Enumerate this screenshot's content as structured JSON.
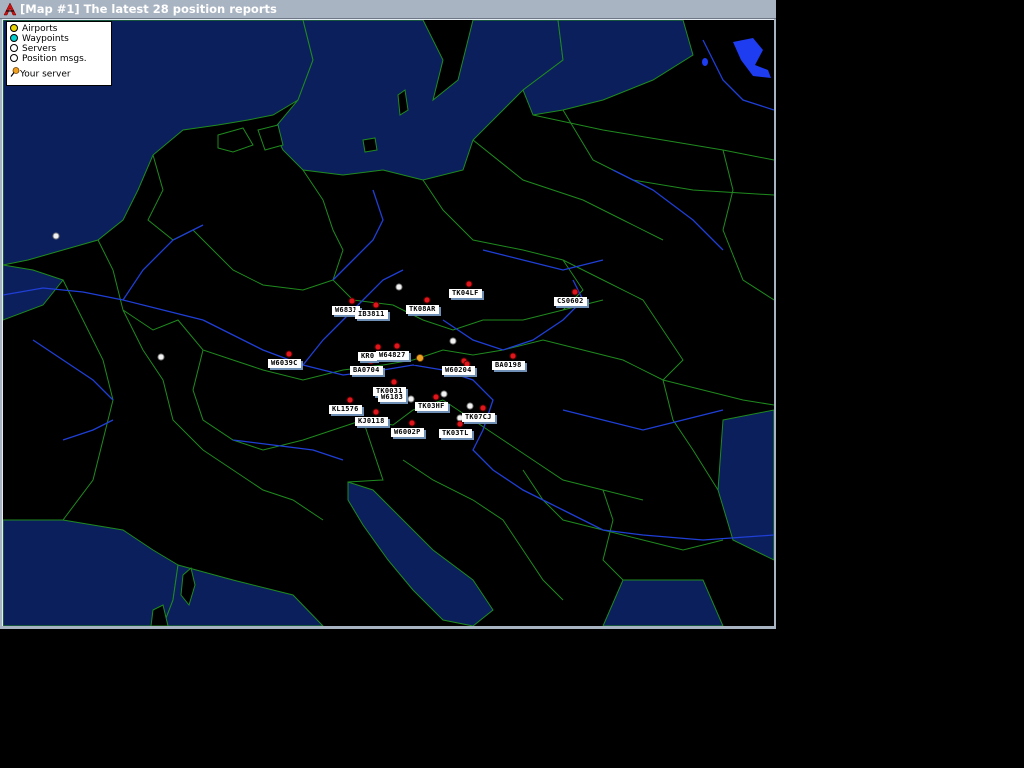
{
  "window": {
    "title": "[Map #1] The latest 28 position reports",
    "colors": {
      "titlebar": "#a9b4c2",
      "sea": "#0b1f5c",
      "land": "#000000",
      "borders": "#1f8a1f",
      "rivers": "#1f3fd6",
      "report_marker": "#e0161c"
    }
  },
  "legend": {
    "items": [
      {
        "label": "Airports",
        "icon": "yellow-dot",
        "color": "#e8d400"
      },
      {
        "label": "Waypoints",
        "icon": "cyan-dot",
        "color": "#00d0d0"
      },
      {
        "label": "Servers",
        "icon": "white-dot",
        "color": "#ffffff"
      },
      {
        "label": "Position msgs.",
        "icon": "white-dot",
        "color": "#ffffff"
      },
      {
        "label": "Your server",
        "icon": "server-pin-icon",
        "color": "#f0a020"
      }
    ]
  },
  "reports": [
    {
      "callsign": "TK04LF"
    },
    {
      "callsign": "CS0602"
    },
    {
      "callsign": "W6831"
    },
    {
      "callsign": "IB3811"
    },
    {
      "callsign": "TK08AR"
    },
    {
      "callsign": "W6039C"
    },
    {
      "callsign": "KR0"
    },
    {
      "callsign": "W64827"
    },
    {
      "callsign": "BA0704"
    },
    {
      "callsign": "W60204"
    },
    {
      "callsign": "BA0198"
    },
    {
      "callsign": "TK0031"
    },
    {
      "callsign": "W6183"
    },
    {
      "callsign": "KL1576"
    },
    {
      "callsign": "TK03HF"
    },
    {
      "callsign": "TK07CJ"
    },
    {
      "callsign": "KJ0118"
    },
    {
      "callsign": "W6002P"
    },
    {
      "callsign": "TK03TL"
    }
  ]
}
